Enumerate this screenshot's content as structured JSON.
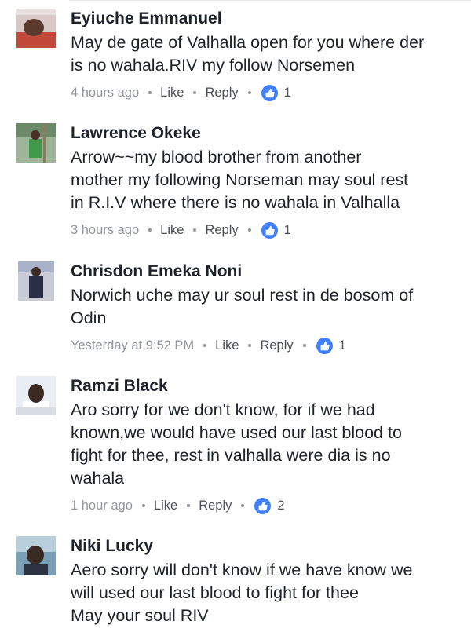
{
  "comments": [
    {
      "author": "Eyiuche Emmanuel",
      "text": "May de gate of Valhalla open for you where der\nis no wahala.RIV my follow Norsemen",
      "time": "4 hours ago",
      "like_label": "Like",
      "reply_label": "Reply",
      "reaction_icon": "thumbs-up-icon",
      "reaction_count": "1"
    },
    {
      "author": "Lawrence Okeke",
      "text": "Arrow~~my blood brother from another\nmother my following Norseman may soul rest\nin R.I.V where there is no wahala in Valhalla",
      "time": "3 hours ago",
      "like_label": "Like",
      "reply_label": "Reply",
      "reaction_icon": "thumbs-up-icon",
      "reaction_count": "1"
    },
    {
      "author": "Chrisdon Emeka Noni",
      "text": "Norwich uche may ur soul rest in de bosom of\nOdin",
      "time": "Yesterday at 9:52 PM",
      "like_label": "Like",
      "reply_label": "Reply",
      "reaction_icon": "thumbs-up-icon",
      "reaction_count": "1"
    },
    {
      "author": "Ramzi Black",
      "text": "Aro sorry for we don't know, for if we had\nknown,we would have used our last blood to\nfight for thee, rest in valhalla were dia is no\nwahala",
      "time": "1 hour ago",
      "like_label": "Like",
      "reply_label": "Reply",
      "reaction_icon": "thumbs-up-icon",
      "reaction_count": "2"
    },
    {
      "author": "Niki Lucky",
      "text": "Aero sorry will don't know if we have know we\nwill used our last blood to fight for thee\nMay your soul RIV"
    }
  ],
  "colors": {
    "text": "#1d2129",
    "meta": "#90949c",
    "action": "#4b4f56",
    "like_blue": "#4080ff"
  }
}
